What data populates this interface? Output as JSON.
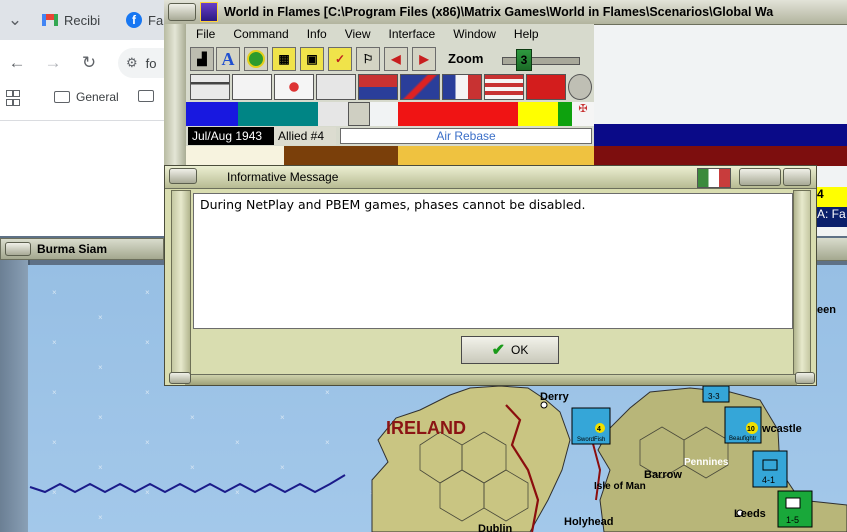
{
  "browser": {
    "tabs": [
      {
        "label": "Recibi"
      },
      {
        "label": "Fa"
      }
    ],
    "address_text": "fo",
    "bookmarks": [
      {
        "label": "General"
      }
    ]
  },
  "wif": {
    "window_title": "World in Flames [C:\\Program Files (x86)\\Matrix Games\\World in Flames\\Scenarios\\Global Wa",
    "menu": [
      {
        "label": "File"
      },
      {
        "label": "Command"
      },
      {
        "label": "Info"
      },
      {
        "label": "View"
      },
      {
        "label": "Interface"
      },
      {
        "label": "Window"
      },
      {
        "label": "Help"
      }
    ],
    "zoom": {
      "label": "Zoom",
      "value": "3"
    },
    "turn_date": "Jul/Aug 1943",
    "active_side": "Allied #4",
    "phase": "Air Rebase",
    "right_side": {
      "number": "4",
      "text": "A: Fa"
    }
  },
  "map_pane": {
    "title": "Burma Siam",
    "labels": {
      "ireland": "IRELAND",
      "derry": "Derry",
      "isle_of_man": "Isle of Man",
      "barrow": "Barrow",
      "pennines": "Pennines",
      "newcastle": "wcastle",
      "leeds": "Leeds",
      "holyhead": "Holyhead",
      "dublin": "Dublin",
      "aberdeen": "een"
    },
    "counters": [
      {
        "name": "SwordFish",
        "value": "4"
      },
      {
        "name": "Beaufightr",
        "value": "10"
      },
      {
        "name": "infantry",
        "value": "3-3"
      },
      {
        "name": "infantry",
        "value": "4-1"
      },
      {
        "name": "HQ",
        "value": "1-5"
      }
    ]
  },
  "dialog": {
    "title": "Informative Message",
    "message": "During NetPlay and PBEM games, phases cannot be disabled.",
    "ok_label": "OK"
  },
  "colors": {
    "dialog_bg": "#d9ddb0",
    "phase_text": "#3b6fc8",
    "allied_blue": "#0a0a88"
  }
}
